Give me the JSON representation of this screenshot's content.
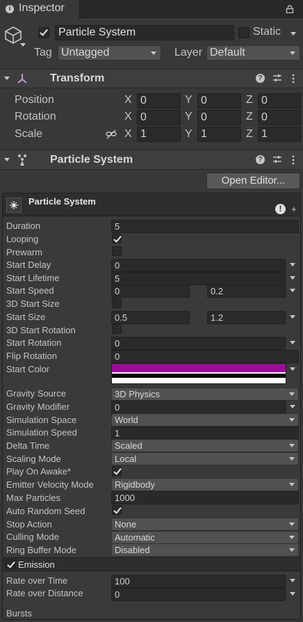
{
  "tab": {
    "title": "Inspector"
  },
  "object": {
    "name": "Particle System",
    "static_label": "Static",
    "tag_label": "Tag",
    "tag_value": "Untagged",
    "layer_label": "Layer",
    "layer_value": "Default"
  },
  "transform": {
    "title": "Transform",
    "rows": [
      {
        "label": "Position",
        "x": "0",
        "y": "0",
        "z": "0"
      },
      {
        "label": "Rotation",
        "x": "0",
        "y": "0",
        "z": "0"
      },
      {
        "label": "Scale",
        "x": "1",
        "y": "1",
        "z": "1"
      }
    ],
    "axis_x": "X",
    "axis_y": "Y",
    "axis_z": "Z"
  },
  "particle_component": {
    "title": "Particle System",
    "open_editor_label": "Open Editor...",
    "module_title": "Particle System"
  },
  "main_module": {
    "duration_label": "Duration",
    "duration_value": "5",
    "looping_label": "Looping",
    "prewarm_label": "Prewarm",
    "start_delay_label": "Start Delay",
    "start_delay_value": "0",
    "start_lifetime_label": "Start Lifetime",
    "start_lifetime_value": "5",
    "start_speed_label": "Start Speed",
    "start_speed_min": "0",
    "start_speed_max": "0.2",
    "start_size_3d_label": "3D Start Size",
    "start_size_label": "Start Size",
    "start_size_min": "0.5",
    "start_size_max": "1.2",
    "start_rotation_3d_label": "3D Start Rotation",
    "start_rotation_label": "Start Rotation",
    "start_rotation_value": "0",
    "flip_rotation_label": "Flip Rotation",
    "flip_rotation_value": "0",
    "start_color_label": "Start Color",
    "start_color_hex": "#9a0d9a",
    "gravity_source_label": "Gravity Source",
    "gravity_source_value": "3D Physics",
    "gravity_modifier_label": "Gravity Modifier",
    "gravity_modifier_value": "0",
    "simulation_space_label": "Simulation Space",
    "simulation_space_value": "World",
    "simulation_speed_label": "Simulation Speed",
    "simulation_speed_value": "1",
    "delta_time_label": "Delta Time",
    "delta_time_value": "Scaled",
    "scaling_mode_label": "Scaling Mode",
    "scaling_mode_value": "Local",
    "play_on_awake_label": "Play On Awake*",
    "emitter_velocity_label": "Emitter Velocity Mode",
    "emitter_velocity_value": "Rigidbody",
    "max_particles_label": "Max Particles",
    "max_particles_value": "1000",
    "auto_random_seed_label": "Auto Random Seed",
    "stop_action_label": "Stop Action",
    "stop_action_value": "None",
    "culling_mode_label": "Culling Mode",
    "culling_mode_value": "Automatic",
    "ring_buffer_label": "Ring Buffer Mode",
    "ring_buffer_value": "Disabled"
  },
  "emission": {
    "title": "Emission",
    "rate_time_label": "Rate over Time",
    "rate_time_value": "100",
    "rate_distance_label": "Rate over Distance",
    "rate_distance_value": "0",
    "bursts_label": "Bursts"
  },
  "colors": {
    "accent": "#9a0d9a",
    "panel": "#383838",
    "field": "#2a2a2a"
  },
  "icons": [
    "info-icon",
    "lock-icon",
    "cube-icon",
    "transform-icon",
    "help-icon",
    "presets-icon",
    "kebab-icon",
    "particle-icon",
    "link-icon",
    "warning-icon",
    "add-icon"
  ]
}
